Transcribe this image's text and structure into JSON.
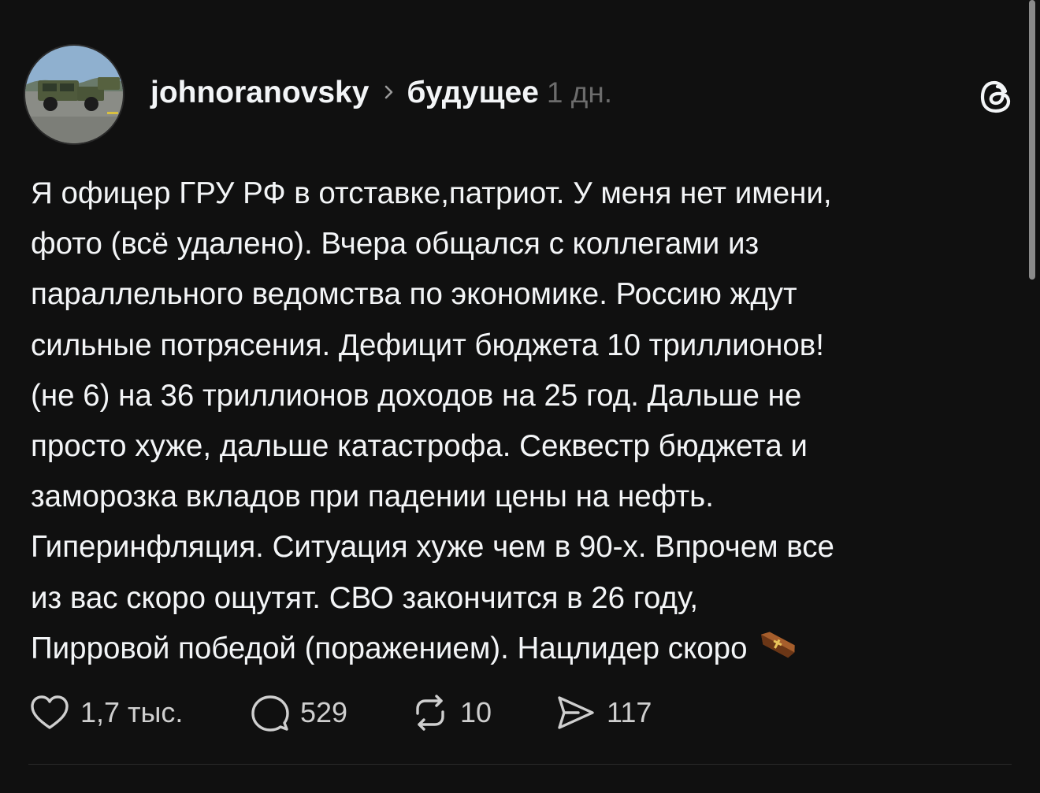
{
  "post": {
    "username": "johnoranovsky",
    "topic": "будущее",
    "time": "1 дн.",
    "text_lines": [
      "Я офицер ГРУ РФ в отставке,патриот. У меня нет имени,",
      "фото (всё удалено). Вчера общался с коллегами из",
      "параллельного ведомства по экономике. Россию ждут",
      "сильные потрясения. Дефицит бюджета 10 триллионов!",
      "(не 6) на 36 триллионов доходов на 25 год. Дальше не",
      "просто хуже, дальше катастрофа. Секвестр бюджета и",
      "заморозка вкладов при падении цены на нефть.",
      "Гиперинфляция. Ситуация хуже чем в 90-х. Впрочем все",
      "из вас скоро ощутят. СВО закончится в 26 году,",
      "Пирровой победой (поражением). Нацлидер скоро"
    ],
    "emoji": "coffin-emoji"
  },
  "actions": {
    "likes": "1,7 тыс.",
    "replies": "529",
    "reposts": "10",
    "shares": "117"
  },
  "icons": {
    "avatar": "avatar-image",
    "threads": "threads-logo-icon"
  }
}
